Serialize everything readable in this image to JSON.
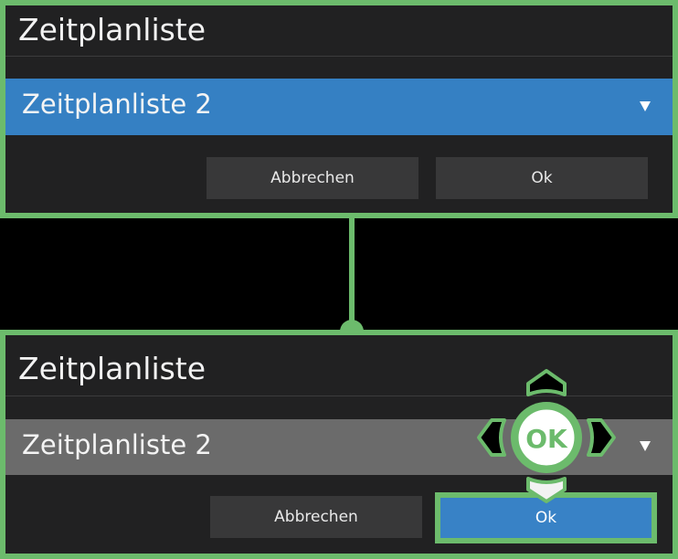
{
  "before": {
    "title": "Zeitplanliste",
    "dropdown": {
      "selected": "Zeitplanliste 2",
      "state": "focused"
    },
    "buttons": {
      "cancel": "Abbrechen",
      "ok": "Ok"
    }
  },
  "after": {
    "title": "Zeitplanliste",
    "dropdown": {
      "selected": "Zeitplanliste 2",
      "state": "unfocused"
    },
    "buttons": {
      "cancel": "Abbrechen",
      "ok": "Ok",
      "ok_state": "focused"
    }
  },
  "remote_hint": {
    "center_label": "OK",
    "icons": [
      "up-arrow-icon",
      "down-arrow-icon",
      "left-arrow-icon",
      "right-arrow-icon",
      "ok-button-icon"
    ]
  },
  "colors": {
    "accent_green": "#6cbb6c",
    "focus_blue": "#3580c3",
    "panel_bg": "#212122",
    "button_bg": "#383839",
    "unfocused_dropdown": "#6b6b6b"
  }
}
